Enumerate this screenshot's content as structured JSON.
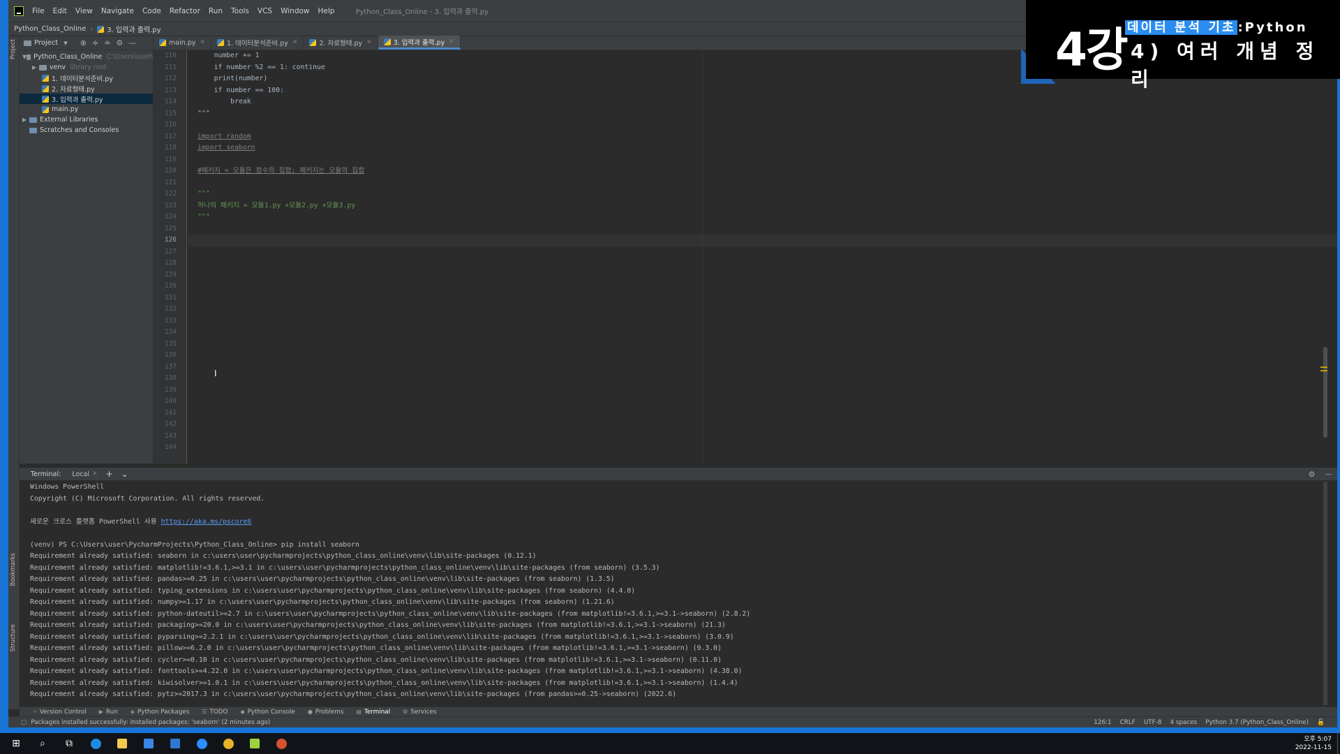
{
  "window": {
    "menu": [
      "File",
      "Edit",
      "View",
      "Navigate",
      "Code",
      "Refactor",
      "Run",
      "Tools",
      "VCS",
      "Window",
      "Help"
    ],
    "title": "Python_Class_Online - 3. 입력과 출력.py"
  },
  "navbar": {
    "project": "Python_Class_Online",
    "file": "3. 입력과 출력.py"
  },
  "project_panel": {
    "header": "Project",
    "tree": [
      {
        "label": "Python_Class_Online",
        "hint": "C:\\Users\\user\\"
      },
      {
        "label": "venv",
        "hint": "library root"
      },
      {
        "label": "1. 데이터분석준비.py",
        "hint": ""
      },
      {
        "label": "2. 자료형태.py",
        "hint": ""
      },
      {
        "label": "3. 입력과 출력.py",
        "hint": ""
      },
      {
        "label": "main.py",
        "hint": ""
      },
      {
        "label": "External Libraries",
        "hint": ""
      },
      {
        "label": "Scratches and Consoles",
        "hint": ""
      }
    ]
  },
  "editor_tabs": [
    "main.py",
    "1. 데이터분석준비.py",
    "2. 자료형태.py",
    "3. 입력과 출력.py"
  ],
  "editor": {
    "line_numbers": [
      "110",
      "111",
      "112",
      "113",
      "114",
      "115",
      "116",
      "117",
      "118",
      "119",
      "120",
      "121",
      "122",
      "123",
      "124",
      "125",
      "126",
      "127",
      "128",
      "129",
      "130",
      "131",
      "132",
      "133",
      "134",
      "135",
      "136",
      "137",
      "138",
      "139",
      "140",
      "141",
      "142",
      "143",
      "144"
    ],
    "lines": [
      "    number += 1",
      "    if number %2 == 1: continue",
      "    print(number)",
      "    if number == 100:",
      "        break",
      "\"\"\"",
      "",
      "import random",
      "import seaborn",
      "",
      "#패키지 = 모듈은 함수의 집합; 패키지는 모듈의 집합",
      "",
      "\"\"\"",
      "하나의 패키지 = 모듈1.py +모듈2.py +모듈3.py",
      "\"\"\""
    ]
  },
  "terminal": {
    "label": "Terminal:",
    "tab": "Local",
    "lines": [
      "Windows PowerShell",
      "Copyright (C) Microsoft Corporation. All rights reserved.",
      "",
      "새로운 크로스 플랫폼 PowerShell 사용 ",
      "",
      "(venv) PS C:\\Users\\user\\PycharmProjects\\Python_Class_Online> pip install seaborn",
      "Requirement already satisfied: seaborn in c:\\users\\user\\pycharmprojects\\python_class_online\\venv\\lib\\site-packages (0.12.1)",
      "Requirement already satisfied: matplotlib!=3.6.1,>=3.1 in c:\\users\\user\\pycharmprojects\\python_class_online\\venv\\lib\\site-packages (from seaborn) (3.5.3)",
      "Requirement already satisfied: pandas>=0.25 in c:\\users\\user\\pycharmprojects\\python_class_online\\venv\\lib\\site-packages (from seaborn) (1.3.5)",
      "Requirement already satisfied: typing_extensions in c:\\users\\user\\pycharmprojects\\python_class_online\\venv\\lib\\site-packages (from seaborn) (4.4.0)",
      "Requirement already satisfied: numpy>=1.17 in c:\\users\\user\\pycharmprojects\\python_class_online\\venv\\lib\\site-packages (from seaborn) (1.21.6)",
      "Requirement already satisfied: python-dateutil>=2.7 in c:\\users\\user\\pycharmprojects\\python_class_online\\venv\\lib\\site-packages (from matplotlib!=3.6.1,>=3.1->seaborn) (2.8.2)",
      "Requirement already satisfied: packaging>=20.0 in c:\\users\\user\\pycharmprojects\\python_class_online\\venv\\lib\\site-packages (from matplotlib!=3.6.1,>=3.1->seaborn) (21.3)",
      "Requirement already satisfied: pyparsing>=2.2.1 in c:\\users\\user\\pycharmprojects\\python_class_online\\venv\\lib\\site-packages (from matplotlib!=3.6.1,>=3.1->seaborn) (3.0.9)",
      "Requirement already satisfied: pillow>=6.2.0 in c:\\users\\user\\pycharmprojects\\python_class_online\\venv\\lib\\site-packages (from matplotlib!=3.6.1,>=3.1->seaborn) (9.3.0)",
      "Requirement already satisfied: cycler>=0.10 in c:\\users\\user\\pycharmprojects\\python_class_online\\venv\\lib\\site-packages (from matplotlib!=3.6.1,>=3.1->seaborn) (0.11.0)",
      "Requirement already satisfied: fonttools>=4.22.0 in c:\\users\\user\\pycharmprojects\\python_class_online\\venv\\lib\\site-packages (from matplotlib!=3.6.1,>=3.1->seaborn) (4.38.0)",
      "Requirement already satisfied: kiwisolver>=1.0.1 in c:\\users\\user\\pycharmprojects\\python_class_online\\venv\\lib\\site-packages (from matplotlib!=3.6.1,>=3.1->seaborn) (1.4.4)",
      "Requirement already satisfied: pytz>=2017.3 in c:\\users\\user\\pycharmprojects\\python_class_online\\venv\\lib\\site-packages (from pandas>=0.25->seaborn) (2022.6)"
    ],
    "link": "https://aka.ms/pscore6"
  },
  "tool_strip": [
    "Version Control",
    "Run",
    "Python Packages",
    "TODO",
    "Python Console",
    "Problems",
    "Terminal",
    "Services"
  ],
  "status": {
    "message": "Packages installed successfully: Installed packages: 'seaborn' (2 minutes ago)",
    "position": "126:1",
    "line_sep": "CRLF",
    "encoding": "UTF-8",
    "indent": "4 spaces",
    "interpreter": "Python 3.7 (Python_Class_Online)"
  },
  "side_labels": {
    "project": "Project",
    "bookmarks": "Bookmarks",
    "structure": "Structure"
  },
  "banner": {
    "lecture": "4강",
    "topic_highlight": "데이터 분석 기초",
    "topic_suffix": ":Python",
    "subtitle": "4) 여러 개념 정리",
    "accent": "#2a8cf0"
  },
  "taskbar": {
    "time": "오후 5:07",
    "date": "2022-11-15",
    "icons": [
      "windows-start-icon",
      "search-icon",
      "task-view-icon",
      "edge-icon",
      "file-explorer-icon",
      "store-icon",
      "mail-icon",
      "zoom-icon",
      "chrome-icon",
      "pycharm-icon",
      "powerpoint-icon"
    ]
  }
}
